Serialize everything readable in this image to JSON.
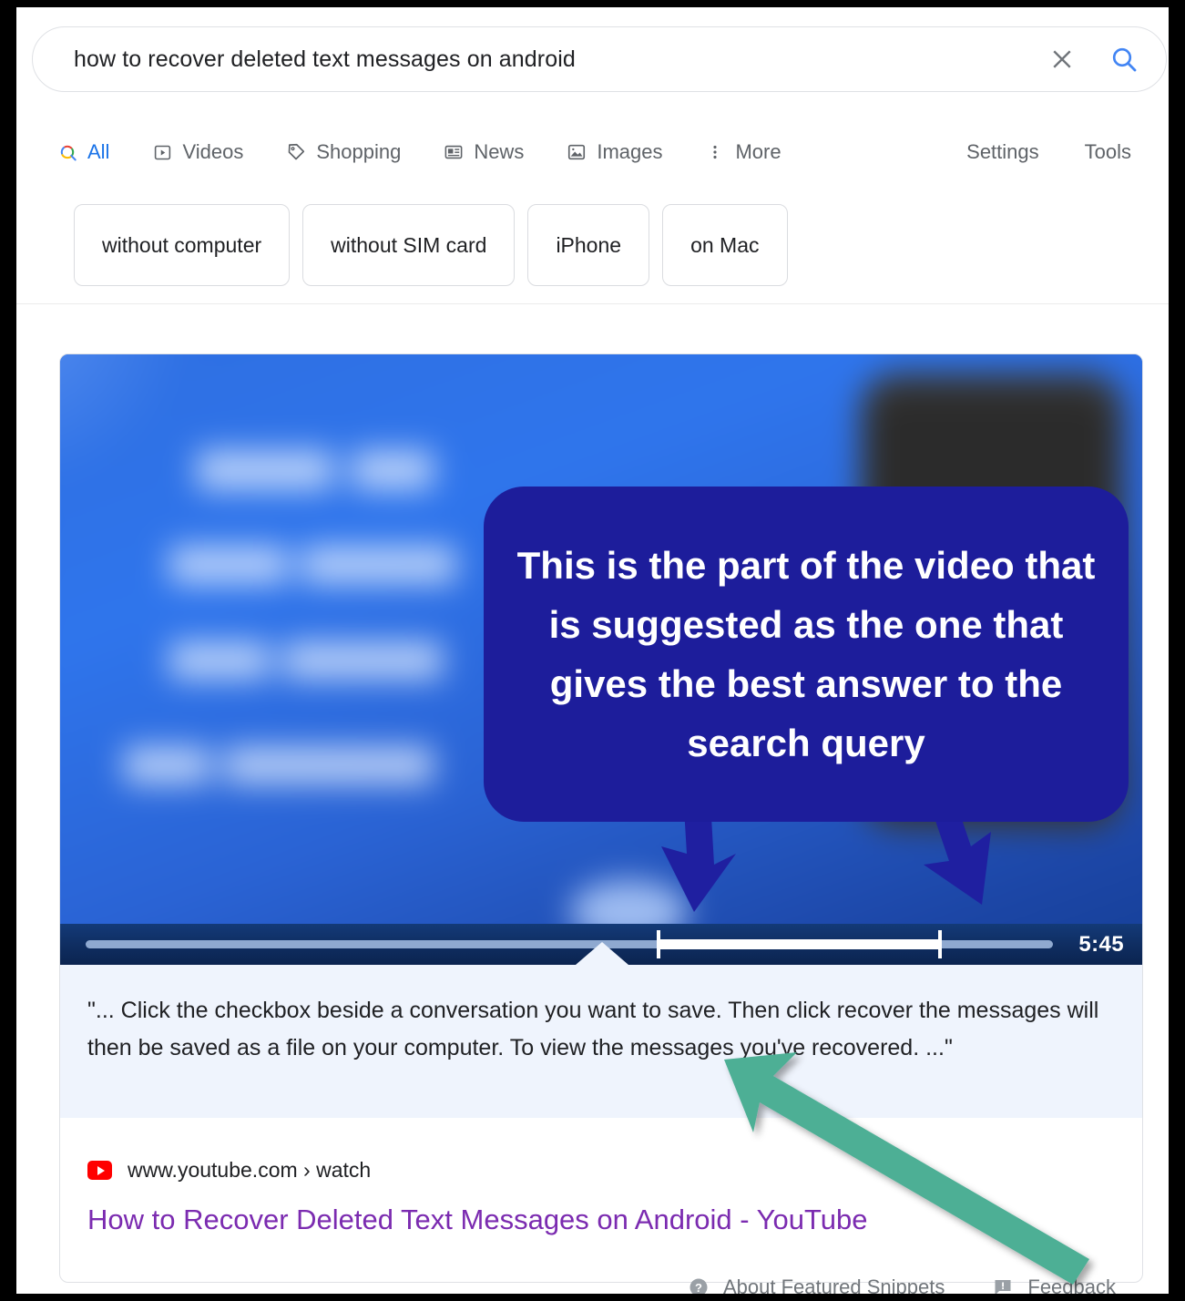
{
  "search": {
    "query": "how to recover deleted text messages on android",
    "placeholder": "Search",
    "clear_icon": "close-icon",
    "search_icon": "search-icon"
  },
  "nav": {
    "tabs": [
      {
        "label": "All",
        "icon": "google-search-icon",
        "active": true
      },
      {
        "label": "Videos",
        "icon": "video-icon",
        "active": false
      },
      {
        "label": "Shopping",
        "icon": "tag-icon",
        "active": false
      },
      {
        "label": "News",
        "icon": "news-icon",
        "active": false
      },
      {
        "label": "Images",
        "icon": "image-icon",
        "active": false
      },
      {
        "label": "More",
        "icon": "more-vertical-icon",
        "active": false
      }
    ],
    "right_links": [
      {
        "label": "Settings"
      },
      {
        "label": "Tools"
      }
    ]
  },
  "chips": [
    {
      "label": "without computer"
    },
    {
      "label": "without SIM card"
    },
    {
      "label": "iPhone"
    },
    {
      "label": "on Mac"
    }
  ],
  "featured_snippet": {
    "video": {
      "thumbnail_text": "HOW TO RECOVER DELETED TEXT MESSAGES",
      "duration": "5:45",
      "highlight_start_pct": 59,
      "highlight_end_pct": 88
    },
    "callout": {
      "text": "This is the part of the video that is suggested as the one that gives the best answer to the search query",
      "color": "#1d1d9b",
      "arrow_color": "#1f1fa0"
    },
    "snippet_text": "\"... Click the checkbox beside a conversation you want to save. Then click recover the messages will then be saved as a file on your computer. To view the messages you've recovered. ...\"",
    "result": {
      "site_icon": "youtube-icon",
      "url": "www.youtube.com › watch",
      "title": "How to Recover Deleted Text Messages on Android - YouTube"
    },
    "annotation_arrow_color": "#4daf95"
  },
  "footer": {
    "about_icon": "help-circle-icon",
    "about_label": "About Featured Snippets",
    "feedback_icon": "feedback-flag-icon",
    "feedback_label": "Feedback"
  }
}
